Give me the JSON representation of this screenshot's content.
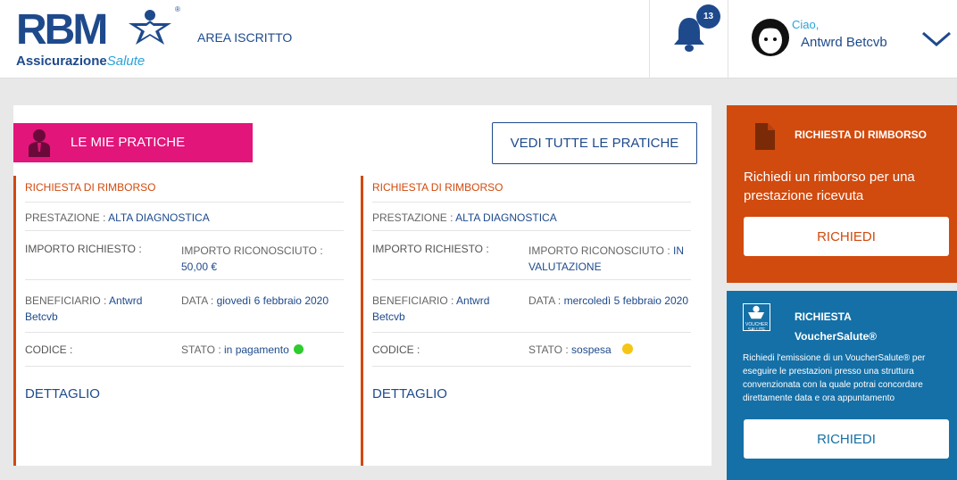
{
  "header": {
    "logo_text": "RBM",
    "logo_sub_bold": "Assicurazione",
    "logo_sub_light": "Salute",
    "logo_reg": "®",
    "area_link": "AREA ISCRITTO",
    "notifications_count": "13",
    "greeting": "Ciao,",
    "user_name": "Antwrd Betcvb"
  },
  "pratiche": {
    "heading": "LE MIE PRATICHE",
    "view_all": "VEDI TUTTE LE PRATICHE",
    "items": [
      {
        "title": "RICHIESTA DI RIMBORSO",
        "prestazione_label": "PRESTAZIONE :",
        "prestazione_value": "ALTA DIAGNOSTICA",
        "importo_richiesto_label": "IMPORTO RICHIESTO :",
        "importo_riconosciuto_label": "IMPORTO RICONOSCIUTO :",
        "importo_riconosciuto_value": "50,00 €",
        "beneficiario_label": "BENEFICIARIO :",
        "beneficiario_value": "Antwrd Betcvb",
        "data_label": "DATA :",
        "data_value": "giovedì 6 febbraio 2020",
        "codice_label": "CODICE :",
        "stato_label": "STATO :",
        "stato_value": "in pagamento",
        "stato_color": "#2ecc2e",
        "dettaglio": "DETTAGLIO"
      },
      {
        "title": "RICHIESTA DI RIMBORSO",
        "prestazione_label": "PRESTAZIONE :",
        "prestazione_value": "ALTA DIAGNOSTICA",
        "importo_richiesto_label": "IMPORTO RICHIESTO :",
        "importo_riconosciuto_label": "IMPORTO RICONOSCIUTO :",
        "importo_riconosciuto_value": "IN VALUTAZIONE",
        "beneficiario_label": "BENEFICIARIO :",
        "beneficiario_value": "Antwrd Betcvb",
        "data_label": "DATA :",
        "data_value": "mercoledì 5 febbraio 2020",
        "codice_label": "CODICE :",
        "stato_label": "STATO :",
        "stato_value": "sospesa",
        "stato_color": "#f5c518",
        "dettaglio": "DETTAGLIO"
      }
    ]
  },
  "rimborso_box": {
    "title": "RICHIESTA DI RIMBORSO",
    "description": "Richiedi un rimborso per una prestazione ricevuta",
    "button": "RICHIEDI",
    "color": "#d14a0e"
  },
  "voucher_box": {
    "logo_text": "VOUCHER SALUTE",
    "title_line1": "RICHIESTA",
    "title_line2": "VoucherSalute®",
    "description": "Richiedi l'emissione di un VoucherSalute® per eseguire le prestazioni presso una struttura convenzionata con la quale potrai concordare direttamente data e ora appuntamento",
    "button": "RICHIEDI",
    "color": "#1570a7"
  },
  "colors": {
    "brand_blue": "#1e4a8c",
    "magenta": "#e2157a",
    "orange": "#d14a0e",
    "blue": "#1570a7"
  },
  "icons": [
    "star-person-icon",
    "bell-icon",
    "headset-avatar-icon",
    "chevron-down-icon",
    "user-icon",
    "document-icon",
    "voucher-logo-icon"
  ]
}
